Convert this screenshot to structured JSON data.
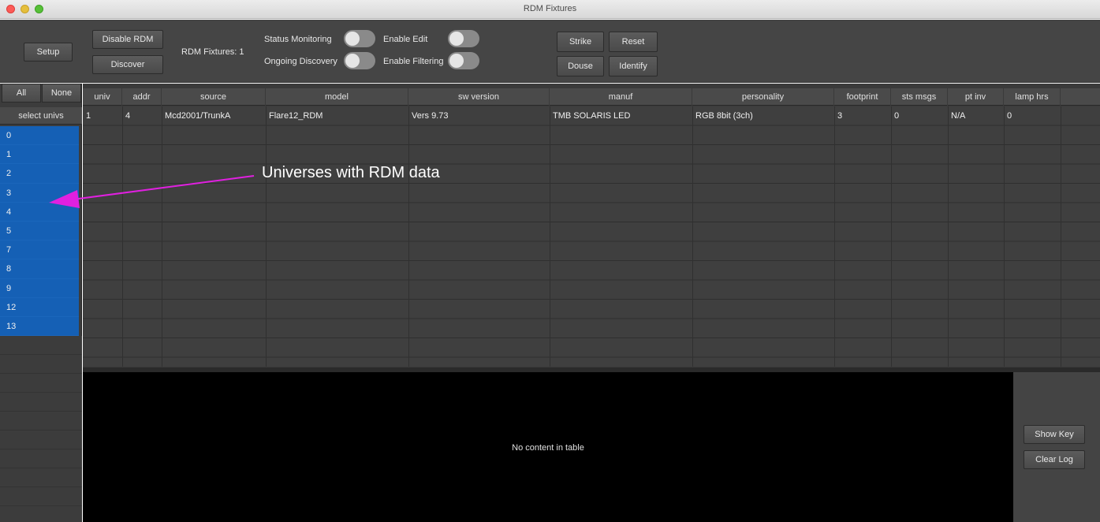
{
  "window": {
    "title": "RDM Fixtures"
  },
  "toolbar": {
    "setup": "Setup",
    "disable_rdm": "Disable RDM",
    "discover": "Discover",
    "fixtures_label": "RDM Fixtures:",
    "fixtures_count": "1",
    "status_monitoring": "Status Monitoring",
    "ongoing_discovery": "Ongoing Discovery",
    "enable_edit": "Enable Edit",
    "enable_filtering": "Enable Filtering",
    "strike": "Strike",
    "reset": "Reset",
    "douse": "Douse",
    "identify": "Identify"
  },
  "left": {
    "all": "All",
    "none": "None",
    "header": "select univs",
    "universes": [
      "0",
      "1",
      "2",
      "3",
      "4",
      "5",
      "7",
      "8",
      "9",
      "12",
      "13"
    ]
  },
  "table": {
    "columns": [
      "univ",
      "addr",
      "source",
      "model",
      "sw version",
      "manuf",
      "personality",
      "footprint",
      "sts msgs",
      "pt inv",
      "lamp hrs"
    ],
    "rows": [
      [
        "1",
        "4",
        "Mcd2001/TrunkA",
        "Flare12_RDM",
        "Vers 9.73",
        "TMB SOLARIS LED",
        "RGB 8bit (3ch)",
        "3",
        "0",
        "N/A",
        "0"
      ]
    ]
  },
  "log": {
    "empty_text": "No content in table",
    "show_key": "Show Key",
    "clear_log": "Clear Log"
  },
  "annotation": {
    "text": "Universes with RDM data",
    "color": "#e020e0"
  }
}
